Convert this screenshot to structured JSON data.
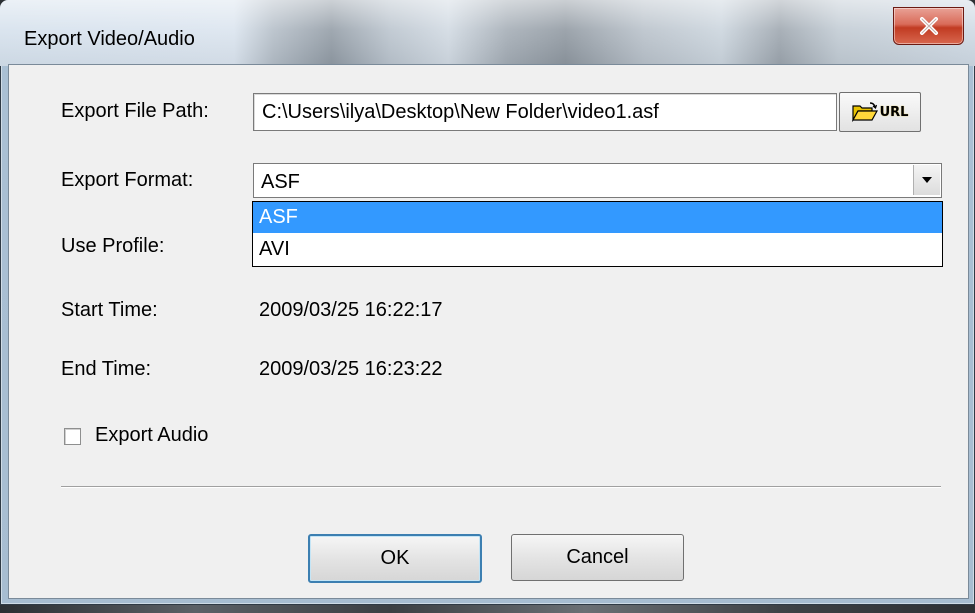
{
  "window": {
    "title": "Export Video/Audio"
  },
  "form": {
    "export_file_path_label": "Export File Path:",
    "export_file_path_value": "C:\\Users\\ilya\\Desktop\\New Folder\\video1.asf",
    "browse_button_text": "URL",
    "export_format_label": "Export Format:",
    "export_format_value": "ASF",
    "export_format_options": [
      "ASF",
      "AVI"
    ],
    "use_profile_label": "Use Profile:",
    "start_time_label": "Start Time:",
    "start_time_value": "2009/03/25 16:22:17",
    "end_time_label": "End Time:",
    "end_time_value": "2009/03/25 16:23:22",
    "export_audio_label": "Export Audio",
    "export_audio_checked": false
  },
  "buttons": {
    "ok_label": "OK",
    "cancel_label": "Cancel"
  },
  "icons": {
    "close": "close-icon",
    "browse": "folder-open-icon",
    "dropdown": "chevron-down-icon"
  },
  "colors": {
    "selection": "#3399ff",
    "close_button": "#c13b22"
  }
}
